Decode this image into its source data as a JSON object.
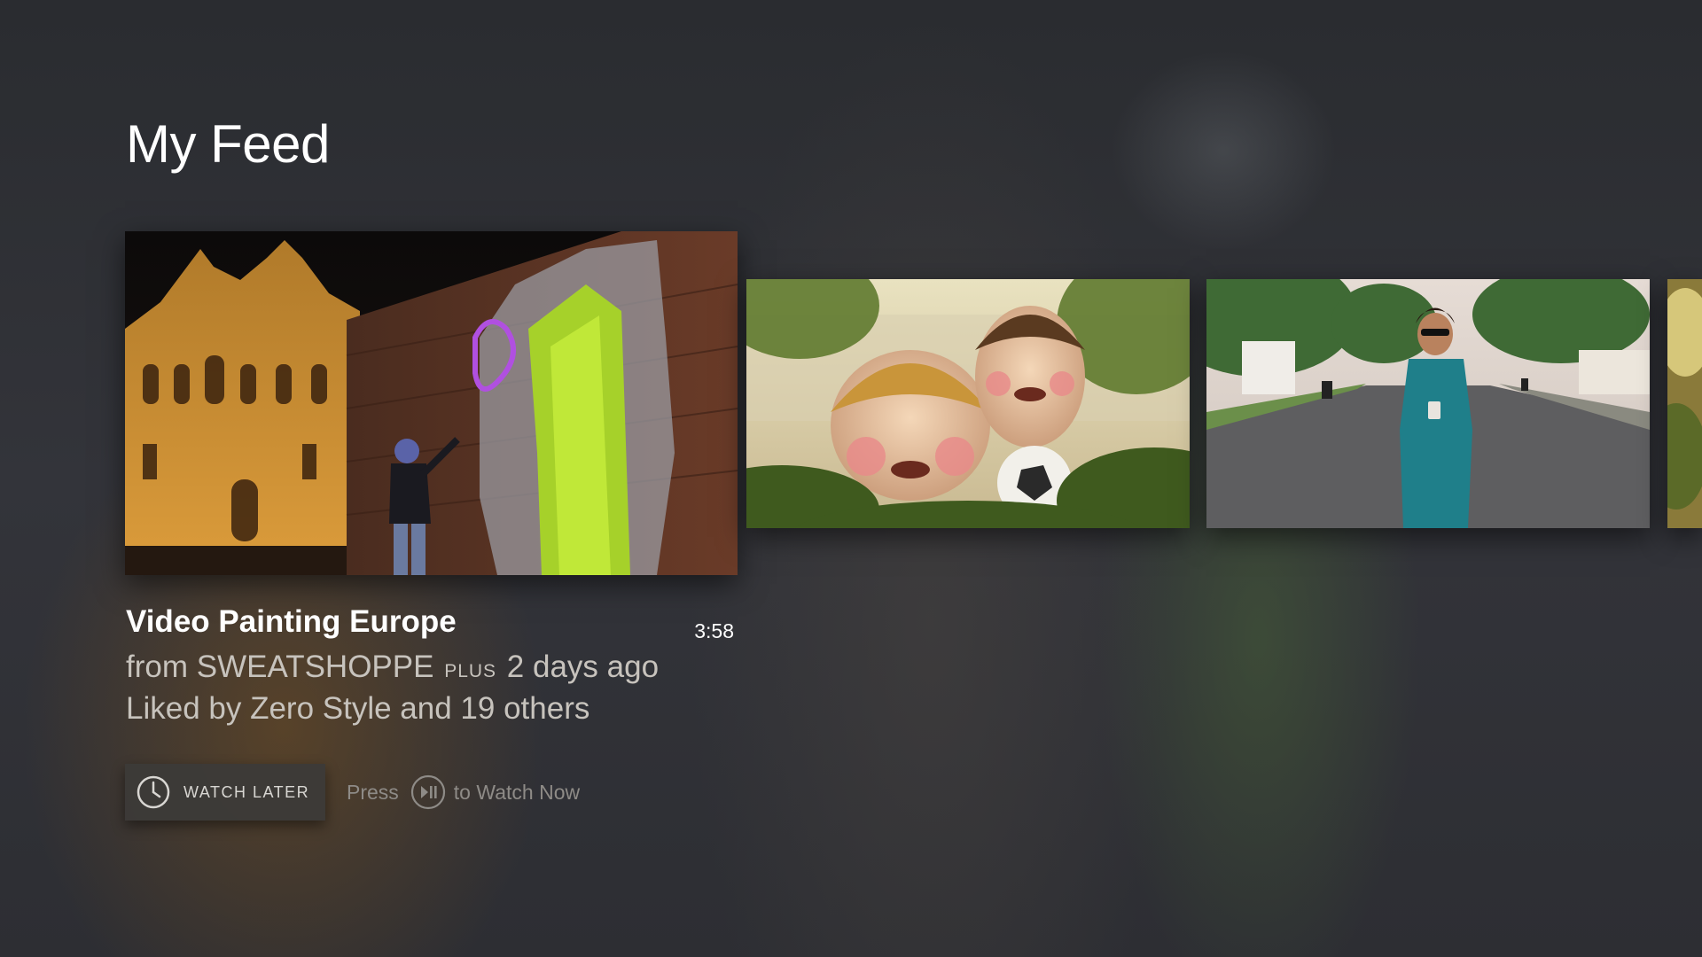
{
  "page": {
    "title": "My Feed"
  },
  "feed": {
    "items": [
      {
        "thumbnail": "graffiti-projection-castle-night",
        "title": "Video Painting Europe",
        "duration": "3:58",
        "from_prefix": "from",
        "channel": "SWEATSHOPPE",
        "badge": "PLUS",
        "age": "2 days ago",
        "likes": "Liked by Zero Style and 19 others"
      },
      {
        "thumbnail": "animated-kids-with-soccer-ball"
      },
      {
        "thumbnail": "woman-in-teal-dress-on-street"
      },
      {
        "thumbnail": "partial-next-item"
      }
    ]
  },
  "actions": {
    "watch_later_label": "WATCH LATER",
    "watch_later_icon": "clock-icon",
    "hint_prefix": "Press",
    "hint_icon": "play-pause-icon",
    "hint_suffix": "to Watch Now"
  }
}
